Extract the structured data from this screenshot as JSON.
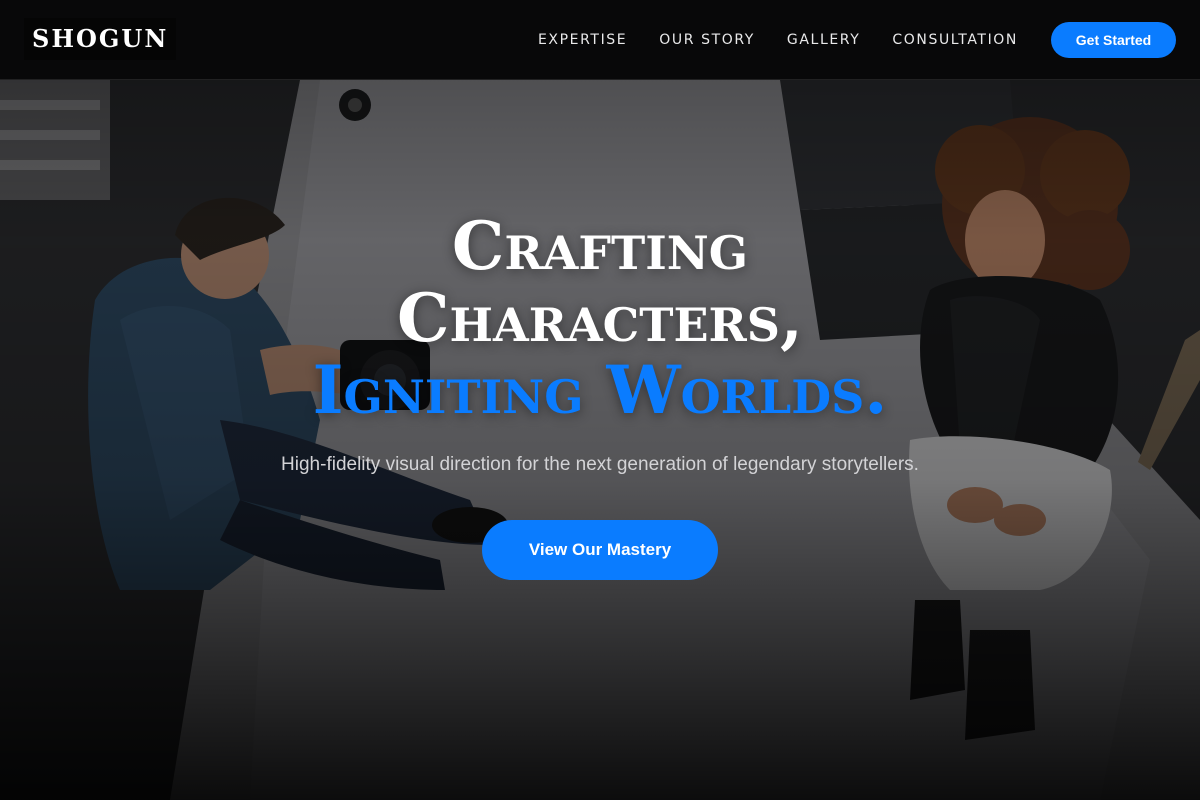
{
  "brand": {
    "logo_text": "SHOGUN"
  },
  "nav": {
    "links": [
      {
        "label": "EXPERTISE"
      },
      {
        "label": "OUR STORY"
      },
      {
        "label": "GALLERY"
      },
      {
        "label": "CONSULTATION"
      }
    ],
    "cta_label": "Get Started"
  },
  "hero": {
    "title_line_1": "Crafting",
    "title_line_2": "Characters,",
    "title_line_3": "Igniting Worlds.",
    "subtitle": "High-fidelity visual direction for the next generation of legendary storytellers.",
    "cta_label": "View Our Mastery",
    "background_image": "photo-studio-session"
  },
  "colors": {
    "accent": "#0a7cff",
    "navbar_bg": "#080809",
    "text_primary": "#ffffff",
    "text_secondary": "#d3d3d6"
  }
}
